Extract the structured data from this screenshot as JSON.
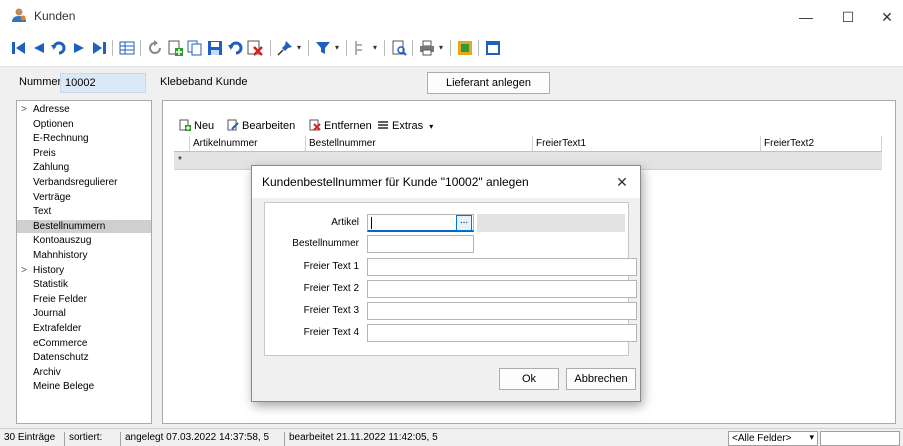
{
  "window": {
    "title": "Kunden",
    "minimize": "—",
    "maximize": "☐",
    "close": "✕"
  },
  "toolbar": {
    "icons": [
      "first-record-icon",
      "prev-record-icon",
      "undo-icon",
      "next-record-icon",
      "last-record-icon",
      "table-view-icon",
      "refresh-icon",
      "new-record-icon",
      "copy-record-icon",
      "save-icon",
      "cancel-edit-icon",
      "delete-icon",
      "pin-icon",
      "filter-icon",
      "tree-icon",
      "search-icon",
      "print-icon",
      "settings-icon",
      "window-icon"
    ],
    "dropdown_glyph": "▾"
  },
  "header": {
    "nummer_label": "Nummer",
    "nummer_value": "10002",
    "kunde_name": "Klebeband Kunde",
    "lieferant_button": "Lieferant anlegen"
  },
  "sidebar": {
    "items": [
      {
        "label": "Adresse",
        "expandable": true
      },
      {
        "label": "Optionen",
        "expandable": false
      },
      {
        "label": "E-Rechnung",
        "expandable": false
      },
      {
        "label": "Preis",
        "expandable": false
      },
      {
        "label": "Zahlung",
        "expandable": false
      },
      {
        "label": "Verbandsregulierer",
        "expandable": false
      },
      {
        "label": "Verträge",
        "expandable": false
      },
      {
        "label": "Text",
        "expandable": false
      },
      {
        "label": "Bestellnummern",
        "expandable": false,
        "active": true
      },
      {
        "label": "Kontoauszug",
        "expandable": false
      },
      {
        "label": "Mahnhistory",
        "expandable": false
      },
      {
        "label": "History",
        "expandable": true
      },
      {
        "label": "Statistik",
        "expandable": false
      },
      {
        "label": "Freie Felder",
        "expandable": false
      },
      {
        "label": "Journal",
        "expandable": false
      },
      {
        "label": "Extrafelder",
        "expandable": false
      },
      {
        "label": "eCommerce",
        "expandable": false
      },
      {
        "label": "Datenschutz",
        "expandable": false
      },
      {
        "label": "Archiv",
        "expandable": false
      },
      {
        "label": "Meine Belege",
        "expandable": false
      }
    ],
    "expand_glyph": ">"
  },
  "grid": {
    "toolbar": {
      "neu": "Neu",
      "bearbeiten": "Bearbeiten",
      "entfernen": "Entfernen",
      "extras": "Extras",
      "extras_glyph": "▾"
    },
    "columns": [
      "Artikelnummer",
      "Bestellnummer",
      "FreierText1",
      "FreierText2"
    ],
    "new_row_marker": "*"
  },
  "dialog": {
    "title": "Kundenbestellnummer für Kunde \"10002\" anlegen",
    "close": "✕",
    "fields": {
      "artikel": "Artikel",
      "bestellnummer": "Bestellnummer",
      "freier_text_1": "Freier Text 1",
      "freier_text_2": "Freier Text 2",
      "freier_text_3": "Freier Text 3",
      "freier_text_4": "Freier Text 4"
    },
    "ellipsis": "...",
    "ok": "Ok",
    "cancel": "Abbrechen"
  },
  "statusbar": {
    "count": "30 Einträge",
    "sorted": "sortiert:",
    "created": "angelegt 07.03.2022 14:37:58, 5",
    "edited": "bearbeitet 21.11.2022 11:42:05, 5",
    "filter_value": "<Alle Felder>",
    "filter_glyph": "▾"
  },
  "colors": {
    "accent": "#0078d7",
    "selected_row": "#cfcfcf",
    "nummer_bg": "#dbe9f6"
  }
}
